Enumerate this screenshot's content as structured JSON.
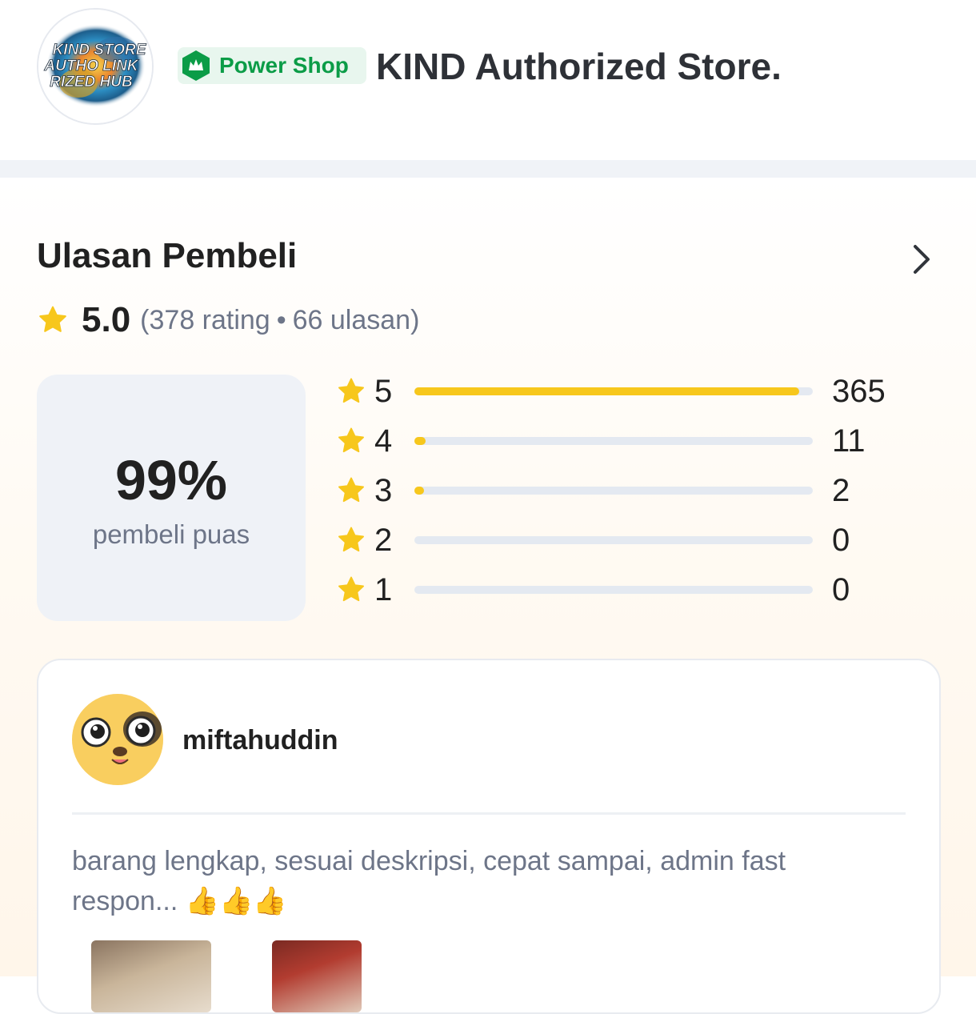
{
  "shop": {
    "logo_text": [
      "KIND STORE",
      "AUTHO LINK",
      "RIZED HUB"
    ],
    "badge_label": "Power Shop",
    "name": "KIND Authorized Store."
  },
  "reviews": {
    "title": "Ulasan Pembeli",
    "average": "5.0",
    "meta_open": "(378 rating",
    "meta_dot": "•",
    "meta_close": "66 ulasan)",
    "satisfaction_percent": "99%",
    "satisfaction_label": "pembeli puas",
    "breakdown": [
      {
        "stars": "5",
        "count": "365",
        "fraction": 0.9656
      },
      {
        "stars": "4",
        "count": "11",
        "fraction": 0.0291
      },
      {
        "stars": "3",
        "count": "2",
        "fraction": 0.0053
      },
      {
        "stars": "2",
        "count": "0",
        "fraction": 0
      },
      {
        "stars": "1",
        "count": "0",
        "fraction": 0
      }
    ],
    "first_review": {
      "reviewer": "miftahuddin",
      "text": "barang lengkap, sesuai deskripsi, cepat sampai, admin fast respon... 👍👍👍"
    }
  },
  "colors": {
    "star": "#f7c71c",
    "bar_fill": "#f7c71c",
    "bar_track": "#e4e9f1",
    "power_shop_green": "#0b9c47",
    "power_shop_bg": "#e8f6ee"
  },
  "icons": {
    "badge": "power-shop-icon",
    "star": "star-icon",
    "chevron": "chevron-right-icon"
  }
}
